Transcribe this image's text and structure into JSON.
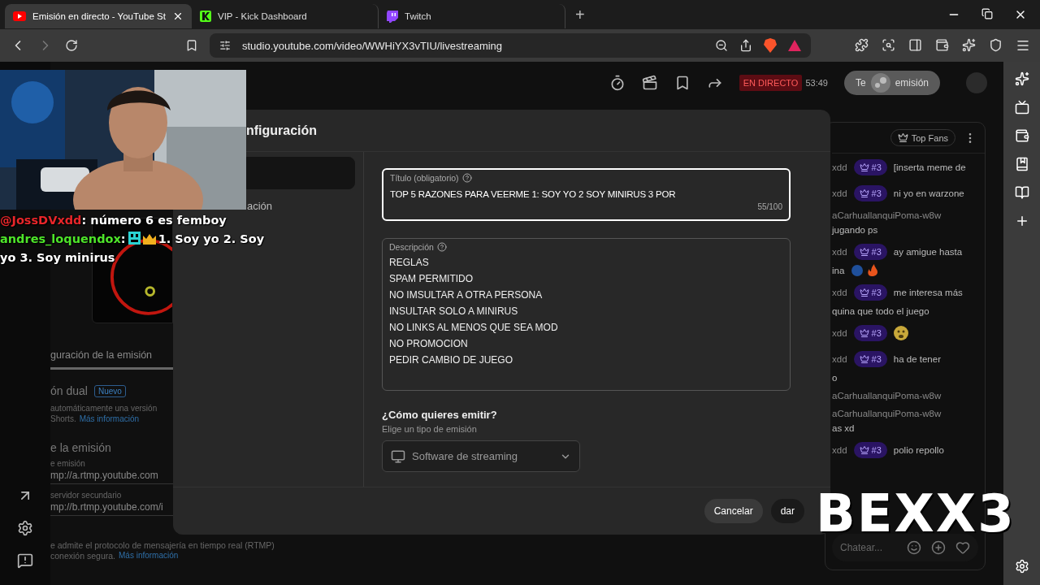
{
  "browser": {
    "tabs": [
      {
        "title": "Emisión en directo - YouTube St",
        "selected": true,
        "kind": "youtube"
      },
      {
        "title": "VIP - Kick Dashboard",
        "selected": false,
        "kind": "kick"
      },
      {
        "title": "Twitch",
        "selected": false,
        "kind": "twitch"
      }
    ],
    "new_tab": "+",
    "url": "studio.youtube.com/video/WWHiYX3vTIU/livestreaming"
  },
  "header": {
    "live_badge": "EN DIRECTO",
    "elapsed": "53:49",
    "end_button": [
      "Te",
      "emisión"
    ]
  },
  "background_page": {
    "tab": "guración de la emisión",
    "dual_title": "ón dual",
    "dual_badge": "Nuevo",
    "dual_text": "automáticamente una versión",
    "dual_text2": "Shorts.",
    "dual_link": "Más información",
    "section": "e la emisión",
    "url_label": "e emisión",
    "url1": "mp://a.rtmp.youtube.com",
    "backup_label": "servidor secundario",
    "url2": "mp://b.rtmp.youtube.com/i",
    "note": "e admite el protocolo de mensajería en tiempo real (RTMP)",
    "note2": "conexión segura.",
    "note_link": "Más información"
  },
  "modal": {
    "title": "nfiguración",
    "nav": [
      {
        "selected": true
      },
      {
        "label": "ación",
        "selected": false
      }
    ],
    "title_field": {
      "label": "Título (obligatorio)",
      "value": "TOP 5 RAZONES PARA VEERME 1: SOY YO 2 SOY MINIRUS 3 POR",
      "counter": "55/100",
      "focused": true
    },
    "description": {
      "label": "Descripción",
      "lines": [
        "REGLAS",
        "SPAM PERMITIDO",
        "NO IMSULTAR A OTRA PERSONA",
        "INSULTAR SOLO A MINIRUS",
        "NO LINKS AL MENOS QUE SEA MOD",
        "NO PROMOCION",
        "PEDIR CAMBIO DE JUEGO"
      ]
    },
    "stream_type": {
      "heading": "¿Cómo quieres emitir?",
      "hint": "Elige un tipo de emisión",
      "value": "Software de streaming"
    },
    "buttons": [
      {
        "label": "Cancelar",
        "kind": "secondary"
      },
      {
        "label": "dar",
        "kind": "primary"
      }
    ]
  },
  "chat": {
    "top_fans": "Top Fans",
    "placeholder": "Chatear...",
    "messages": [
      {
        "kind": "badge",
        "author": "xdd",
        "rank": "#3",
        "text": "[inserta meme de"
      },
      {
        "kind": "badge",
        "author": "xdd",
        "rank": "#3",
        "text": "ni yo en warzone"
      },
      {
        "kind": "plain",
        "author": "aCarhuallanquiPoma-w8w",
        "text2": "jugando ps"
      },
      {
        "kind": "badge_emojis",
        "author": "xdd",
        "rank": "#3",
        "text": "ay amigue hasta",
        "text2": "ina"
      },
      {
        "kind": "badge",
        "author": "xdd",
        "rank": "#3",
        "text": "me interesa más",
        "text2": "quina que todo el juego"
      },
      {
        "kind": "badge_emoji",
        "author": "xdd",
        "rank": "#3"
      },
      {
        "kind": "badge",
        "author": "xdd",
        "rank": "#3",
        "text": "ha de tener",
        "text2": "o"
      },
      {
        "kind": "plain",
        "author": "aCarhuallanquiPoma-w8w"
      },
      {
        "kind": "plain",
        "author": "aCarhuallanquiPoma-w8w",
        "text2": "as xd"
      },
      {
        "kind": "badge",
        "author": "xdd",
        "rank": "#3",
        "text": "polio repollo"
      }
    ]
  },
  "overlay_chat": [
    {
      "kind": "plain",
      "user": "@JossDVxdd",
      "color": "#e8262a",
      "text": ": número 6 es femboy"
    },
    {
      "kind": "emotes",
      "user": "andres_loquendox",
      "color": "#4ee52a",
      "prefix": ":",
      "text": "1. Soy yo 2. Soy yo 3. Soy minirus"
    }
  ],
  "stream_logo": "BEXX3"
}
